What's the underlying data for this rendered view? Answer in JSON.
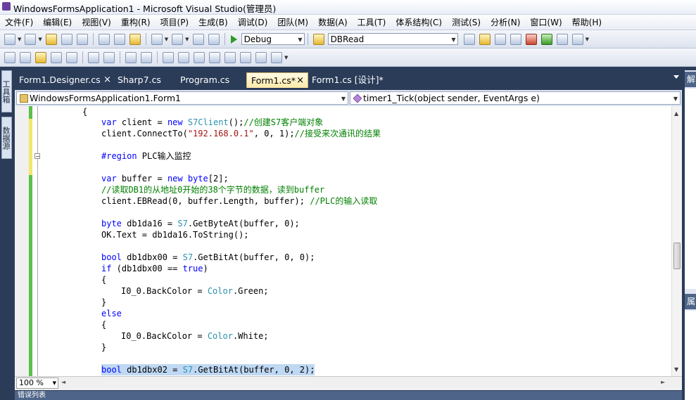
{
  "window": {
    "title": "WindowsFormsApplication1 - Microsoft Visual Studio(管理员)"
  },
  "menu": [
    "文件(F)",
    "编辑(E)",
    "视图(V)",
    "重构(R)",
    "项目(P)",
    "生成(B)",
    "调试(D)",
    "团队(M)",
    "数据(A)",
    "工具(T)",
    "体系结构(C)",
    "测试(S)",
    "分析(N)",
    "窗口(W)",
    "帮助(H)"
  ],
  "toolbar": {
    "config": "Debug",
    "find": "DBRead"
  },
  "side_tabs": {
    "toolbox": "工具箱",
    "datasource": "数据源"
  },
  "tabs": [
    {
      "label": "Form1.Designer.cs",
      "close": "×"
    },
    {
      "label": "Sharp7.cs"
    },
    {
      "label": "Program.cs"
    },
    {
      "label": "Form1.cs*",
      "close": "×"
    },
    {
      "label": "Form1.cs [设计]*"
    }
  ],
  "nav": {
    "class": "WindowsFormsApplication1.Form1",
    "member": "timer1_Tick(object sender, EventArgs e)"
  },
  "editor": {
    "zoom": "100 %"
  },
  "right_panel": {
    "solution": "解",
    "props": "属"
  },
  "bottom_panel": {
    "title": "错误列表"
  },
  "code": {
    "l01": "{",
    "l02": {
      "a": "var",
      "b": " client = ",
      "c": "new",
      "d": "S7Client",
      "e": "();",
      "f": "//创建S7客户端对象"
    },
    "l03": {
      "a": "client.ConnectTo(",
      "b": "\"192.168.0.1\"",
      "c": ", 0, 1);",
      "d": "//接受来次通讯的结果"
    },
    "l04": {
      "a": "#region",
      "b": " PLC输入监控"
    },
    "l05": {
      "a": "var",
      "b": " buffer = ",
      "c": "new",
      "d": "byte",
      "e": "[2];"
    },
    "l06": "//读取DB1的从地址0开始的38个字节的数据，读到buffer",
    "l07": {
      "a": "client.EBRead(0, buffer.Length, buffer); ",
      "b": "//PLC的输入读取"
    },
    "l08": {
      "a": "byte",
      "b": " db1da16 = ",
      "c": "S7",
      "d": ".GetByteAt(buffer, 0);"
    },
    "l09": "OK.Text = db1da16.ToString();",
    "l10": {
      "a": "bool",
      "b": " db1dbx00 = ",
      "c": "S7",
      "d": ".GetBitAt(buffer, 0, 0);"
    },
    "l11": {
      "a": "if",
      "b": " (db1dbx00 == ",
      "c": "true",
      "d": ")"
    },
    "l12": "{",
    "l13": {
      "a": "I0_0.BackColor = ",
      "b": "Color",
      "c": ".Green;"
    },
    "l14": "}",
    "l15": "else",
    "l16": "{",
    "l17": {
      "a": "I0_0.BackColor = ",
      "b": "Color",
      "c": ".White;"
    },
    "l18": "}",
    "l19": {
      "a": "bool",
      "b": " db1dbx02 = ",
      "c": "S7",
      "d": ".GetBitAt(buffer, 0, 2);"
    }
  }
}
